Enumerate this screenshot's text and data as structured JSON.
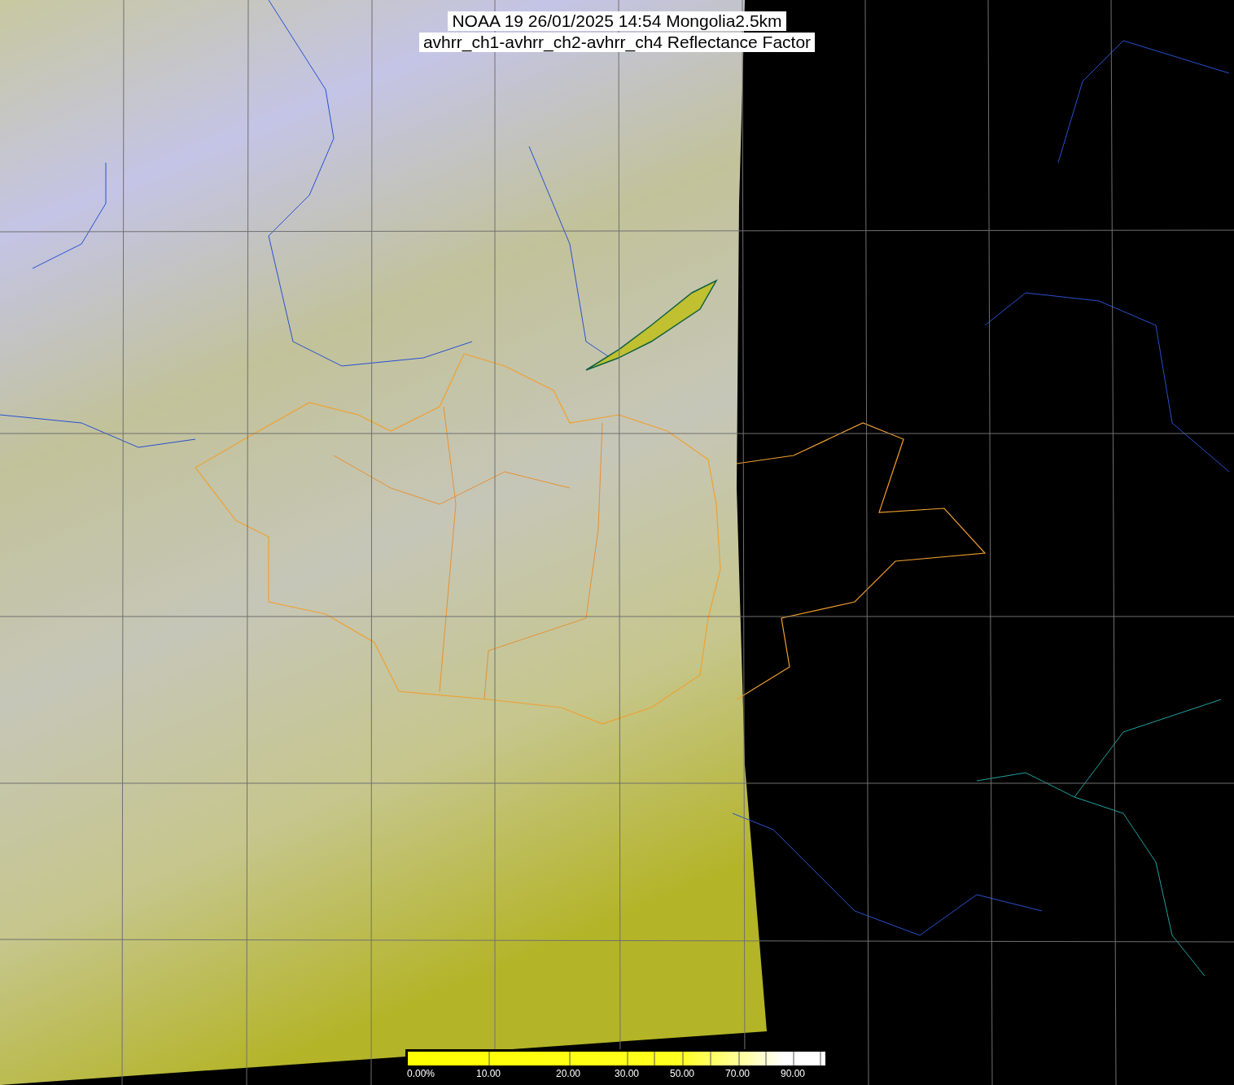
{
  "title": {
    "lines": [
      "NOAA 19 26/01/2025 14:54 Mongolia2.5km",
      "avhrr_ch1-avhrr_ch2-avhrr_ch4 Reflectance Factor"
    ]
  },
  "colorbar": {
    "labels": [
      "0.00%",
      "10.00",
      "20.00",
      "30.00",
      "50.00",
      "70.00",
      "90.00"
    ]
  }
}
